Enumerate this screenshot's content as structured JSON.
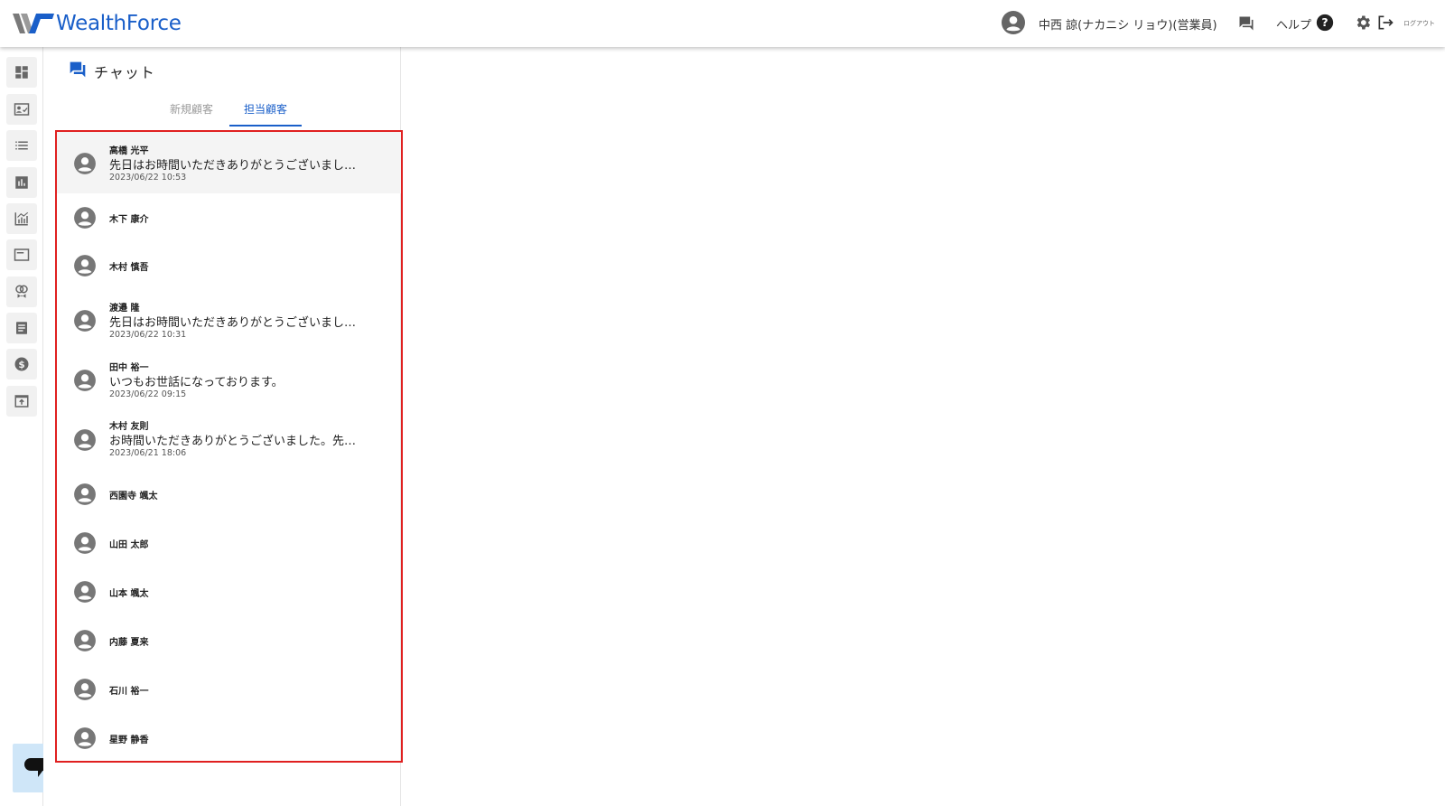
{
  "header": {
    "logo_text": "WealthForce",
    "user_name": "中西 諒(ナカニシ リョウ)(営業員)",
    "help_label": "ヘルプ",
    "logout_label": "ログアウト",
    "brand_color": "#1a5fc9"
  },
  "rail": {
    "items": [
      "dashboard-icon",
      "contact-card-icon",
      "list-icon",
      "bar-chart-icon",
      "analytics-icon",
      "card-icon",
      "proposal-icon",
      "document-icon",
      "dollar-icon",
      "export-icon"
    ]
  },
  "panel": {
    "title": "チャット",
    "tabs": [
      {
        "label": "新規顧客",
        "active": false
      },
      {
        "label": "担当顧客",
        "active": true
      }
    ]
  },
  "chats": [
    {
      "name": "高橋 光平",
      "message": "先日はお時間いただきありがとうございました。",
      "time": "2023/06/22 10:53",
      "selected": true
    },
    {
      "name": "木下 康介",
      "message": "",
      "time": ""
    },
    {
      "name": "木村 慎吾",
      "message": "",
      "time": ""
    },
    {
      "name": "渡邉 隆",
      "message": "先日はお時間いただきありがとうございました。",
      "time": "2023/06/22 10:31"
    },
    {
      "name": "田中 裕一",
      "message": "いつもお世話になっております。",
      "time": "2023/06/22 09:15"
    },
    {
      "name": "木村 友則",
      "message": "お時間いただきありがとうございました。先日の件",
      "time": "2023/06/21 18:06"
    },
    {
      "name": "西園寺 颯太",
      "message": "",
      "time": ""
    },
    {
      "name": "山田 太郎",
      "message": "",
      "time": ""
    },
    {
      "name": "山本 颯太",
      "message": "",
      "time": ""
    },
    {
      "name": "内藤 夏来",
      "message": "",
      "time": ""
    },
    {
      "name": "石川 裕一",
      "message": "",
      "time": ""
    },
    {
      "name": "星野 静香",
      "message": "",
      "time": ""
    }
  ]
}
